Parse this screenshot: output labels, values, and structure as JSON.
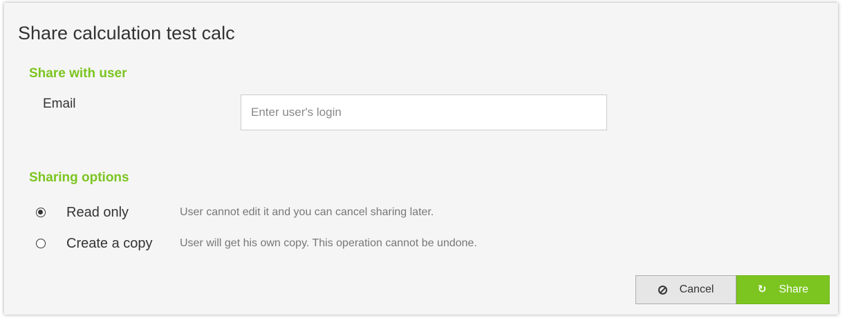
{
  "dialog": {
    "title": "Share calculation test calc"
  },
  "share_with_user": {
    "heading": "Share with user",
    "email_label": "Email",
    "email_value": "",
    "email_placeholder": "Enter user's login"
  },
  "sharing_options": {
    "heading": "Sharing options",
    "options": [
      {
        "label": "Read only",
        "description": "User cannot edit it and you can cancel sharing later.",
        "selected": true
      },
      {
        "label": "Create a copy",
        "description": "User will get his own copy. This operation cannot be undone.",
        "selected": false
      }
    ]
  },
  "buttons": {
    "cancel_label": "Cancel",
    "cancel_icon": "ban-icon",
    "share_label": "Share",
    "share_icon": "share-sync-icon"
  },
  "colors": {
    "accent": "#7cc520",
    "dialog_background": "#f5f5f5",
    "cancel_button": "#e6e6e6"
  }
}
